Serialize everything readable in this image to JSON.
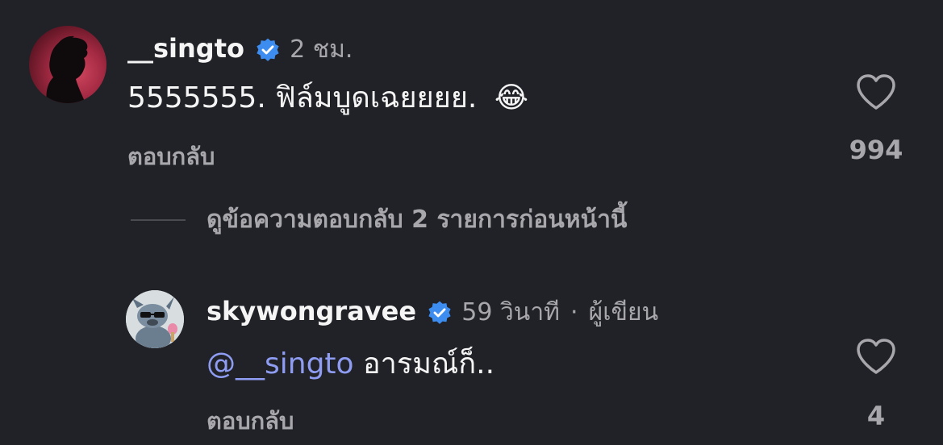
{
  "comment": {
    "username": "__singto",
    "verified": true,
    "time": "2 ชม.",
    "text": "5555555. ฟิล์มบูดเฉยยยย.",
    "emoji": "😂",
    "reply_label": "ตอบกลับ",
    "like_count": "994",
    "view_replies_label": "ดูข้อความตอบกลับ 2 รายการก่อนหน้านี้"
  },
  "reply": {
    "username": "skywongravee",
    "verified": true,
    "time": "59 วินาที",
    "separator": "·",
    "author_label": "ผู้เขียน",
    "mention": "@__singto",
    "text": " อารมณ์ก็..",
    "reply_label": "ตอบกลับ",
    "like_count": "4"
  },
  "colors": {
    "background": "#212227",
    "verified_badge": "#3d8df0",
    "mention": "#8e9cf2",
    "secondary_text": "#a8a8ac"
  }
}
